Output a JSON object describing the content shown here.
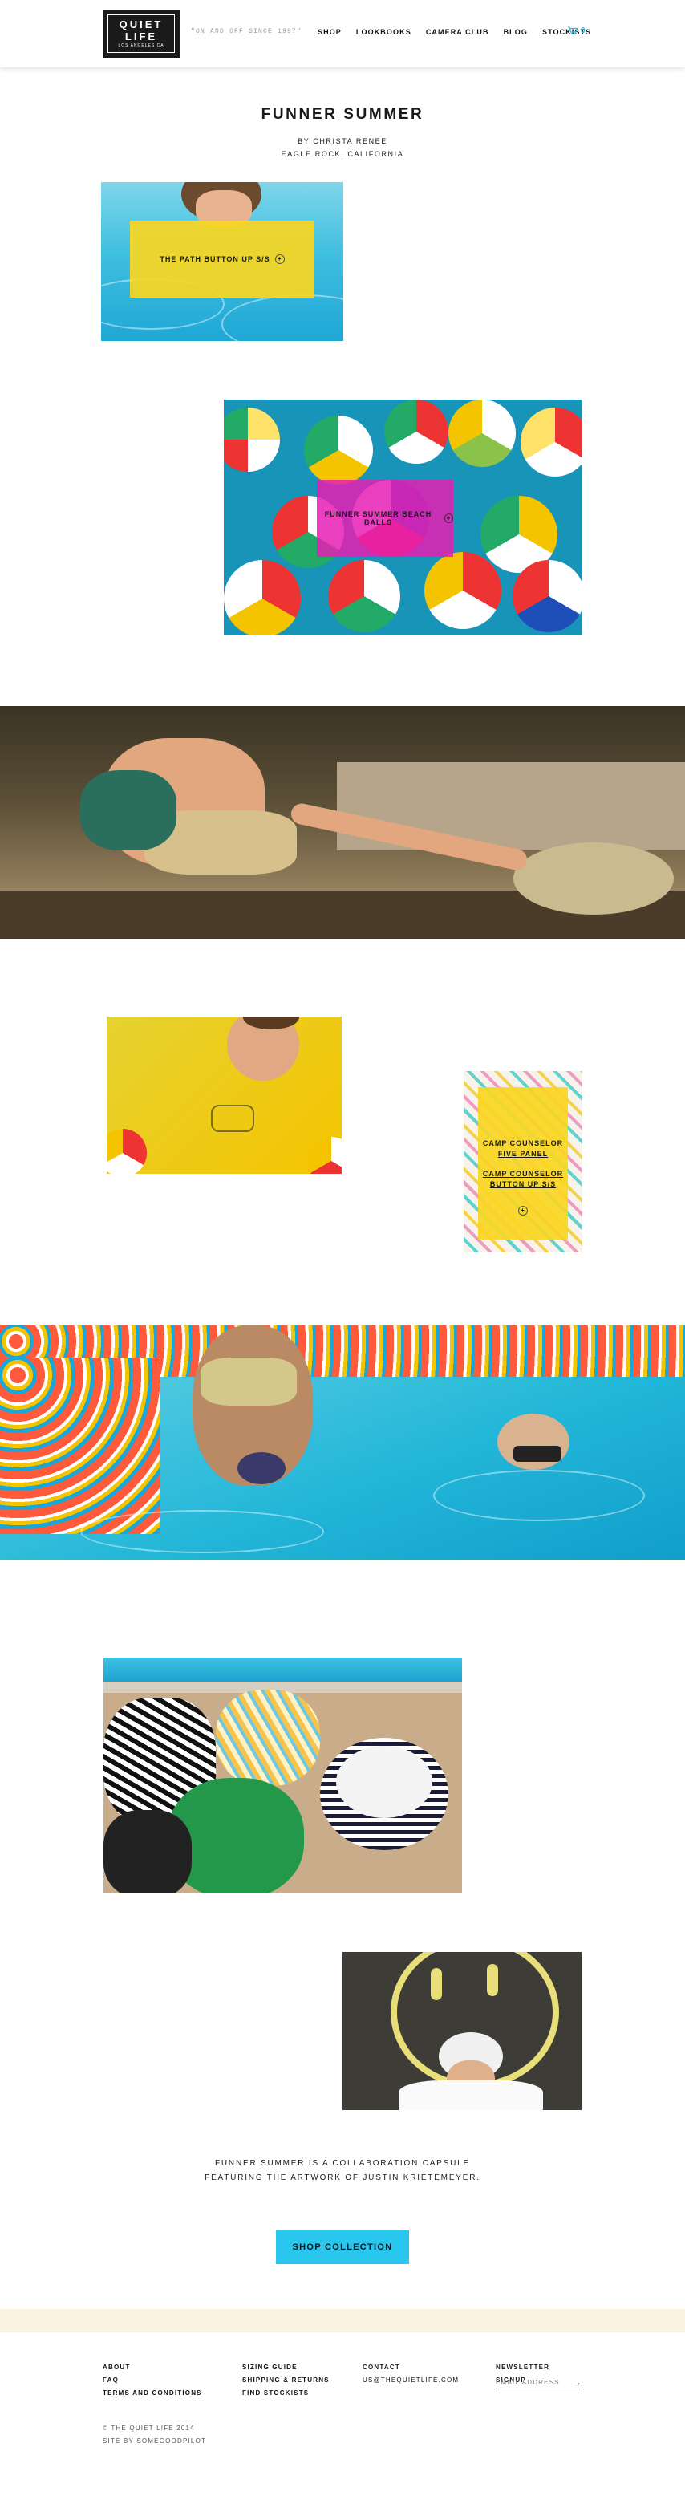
{
  "header": {
    "logo": {
      "line1": "QUIET",
      "line2": "LIFE",
      "line3": "LOS ANGELES CA"
    },
    "tagline": "\"ON AND OFF SINCE 1997\"",
    "nav": [
      "SHOP",
      "LOOKBOOKS",
      "CAMERA CLUB",
      "BLOG",
      "STOCKISTS"
    ],
    "cart_count": "0",
    "cart_icon": "cart-icon",
    "accent": "#2bb6d9"
  },
  "article": {
    "title": "FUNNER SUMMER",
    "byline_1": "BY CHRISTA RENEE",
    "byline_2": "EAGLE ROCK, CALIFORNIA"
  },
  "callouts": {
    "path_button_up": "THE PATH BUTTON UP S/S",
    "beach_balls": "FUNNER SUMMER BEACH BALLS",
    "five_panel": "CAMP COUNSELOR FIVE PANEL",
    "counselor_button_up": "CAMP COUNSELOR BUTTON UP S/S"
  },
  "blurb": {
    "line1": "FUNNER SUMMER IS A COLLABORATION CAPSULE",
    "line2": "FEATURING THE ARTWORK OF JUSTIN KRIETEMEYER."
  },
  "cta": {
    "shop_collection": "SHOP COLLECTION",
    "color": "#29c6ee"
  },
  "footer": {
    "col1": [
      "ABOUT",
      "FAQ",
      "TERMS AND CONDITIONS"
    ],
    "col2": [
      "SIZING GUIDE",
      "SHIPPING & RETURNS",
      "FIND STOCKISTS"
    ],
    "contact_heading": "CONTACT",
    "contact_email": "US@THEQUIETLIFE.COM",
    "newsletter_heading": "NEWSLETTER SIGNUP",
    "newsletter_placeholder": "EMAIL ADDRESS",
    "copyright": "© THE QUIET LIFE 2014",
    "credit": "SITE BY SOMEGOODPILOT"
  }
}
